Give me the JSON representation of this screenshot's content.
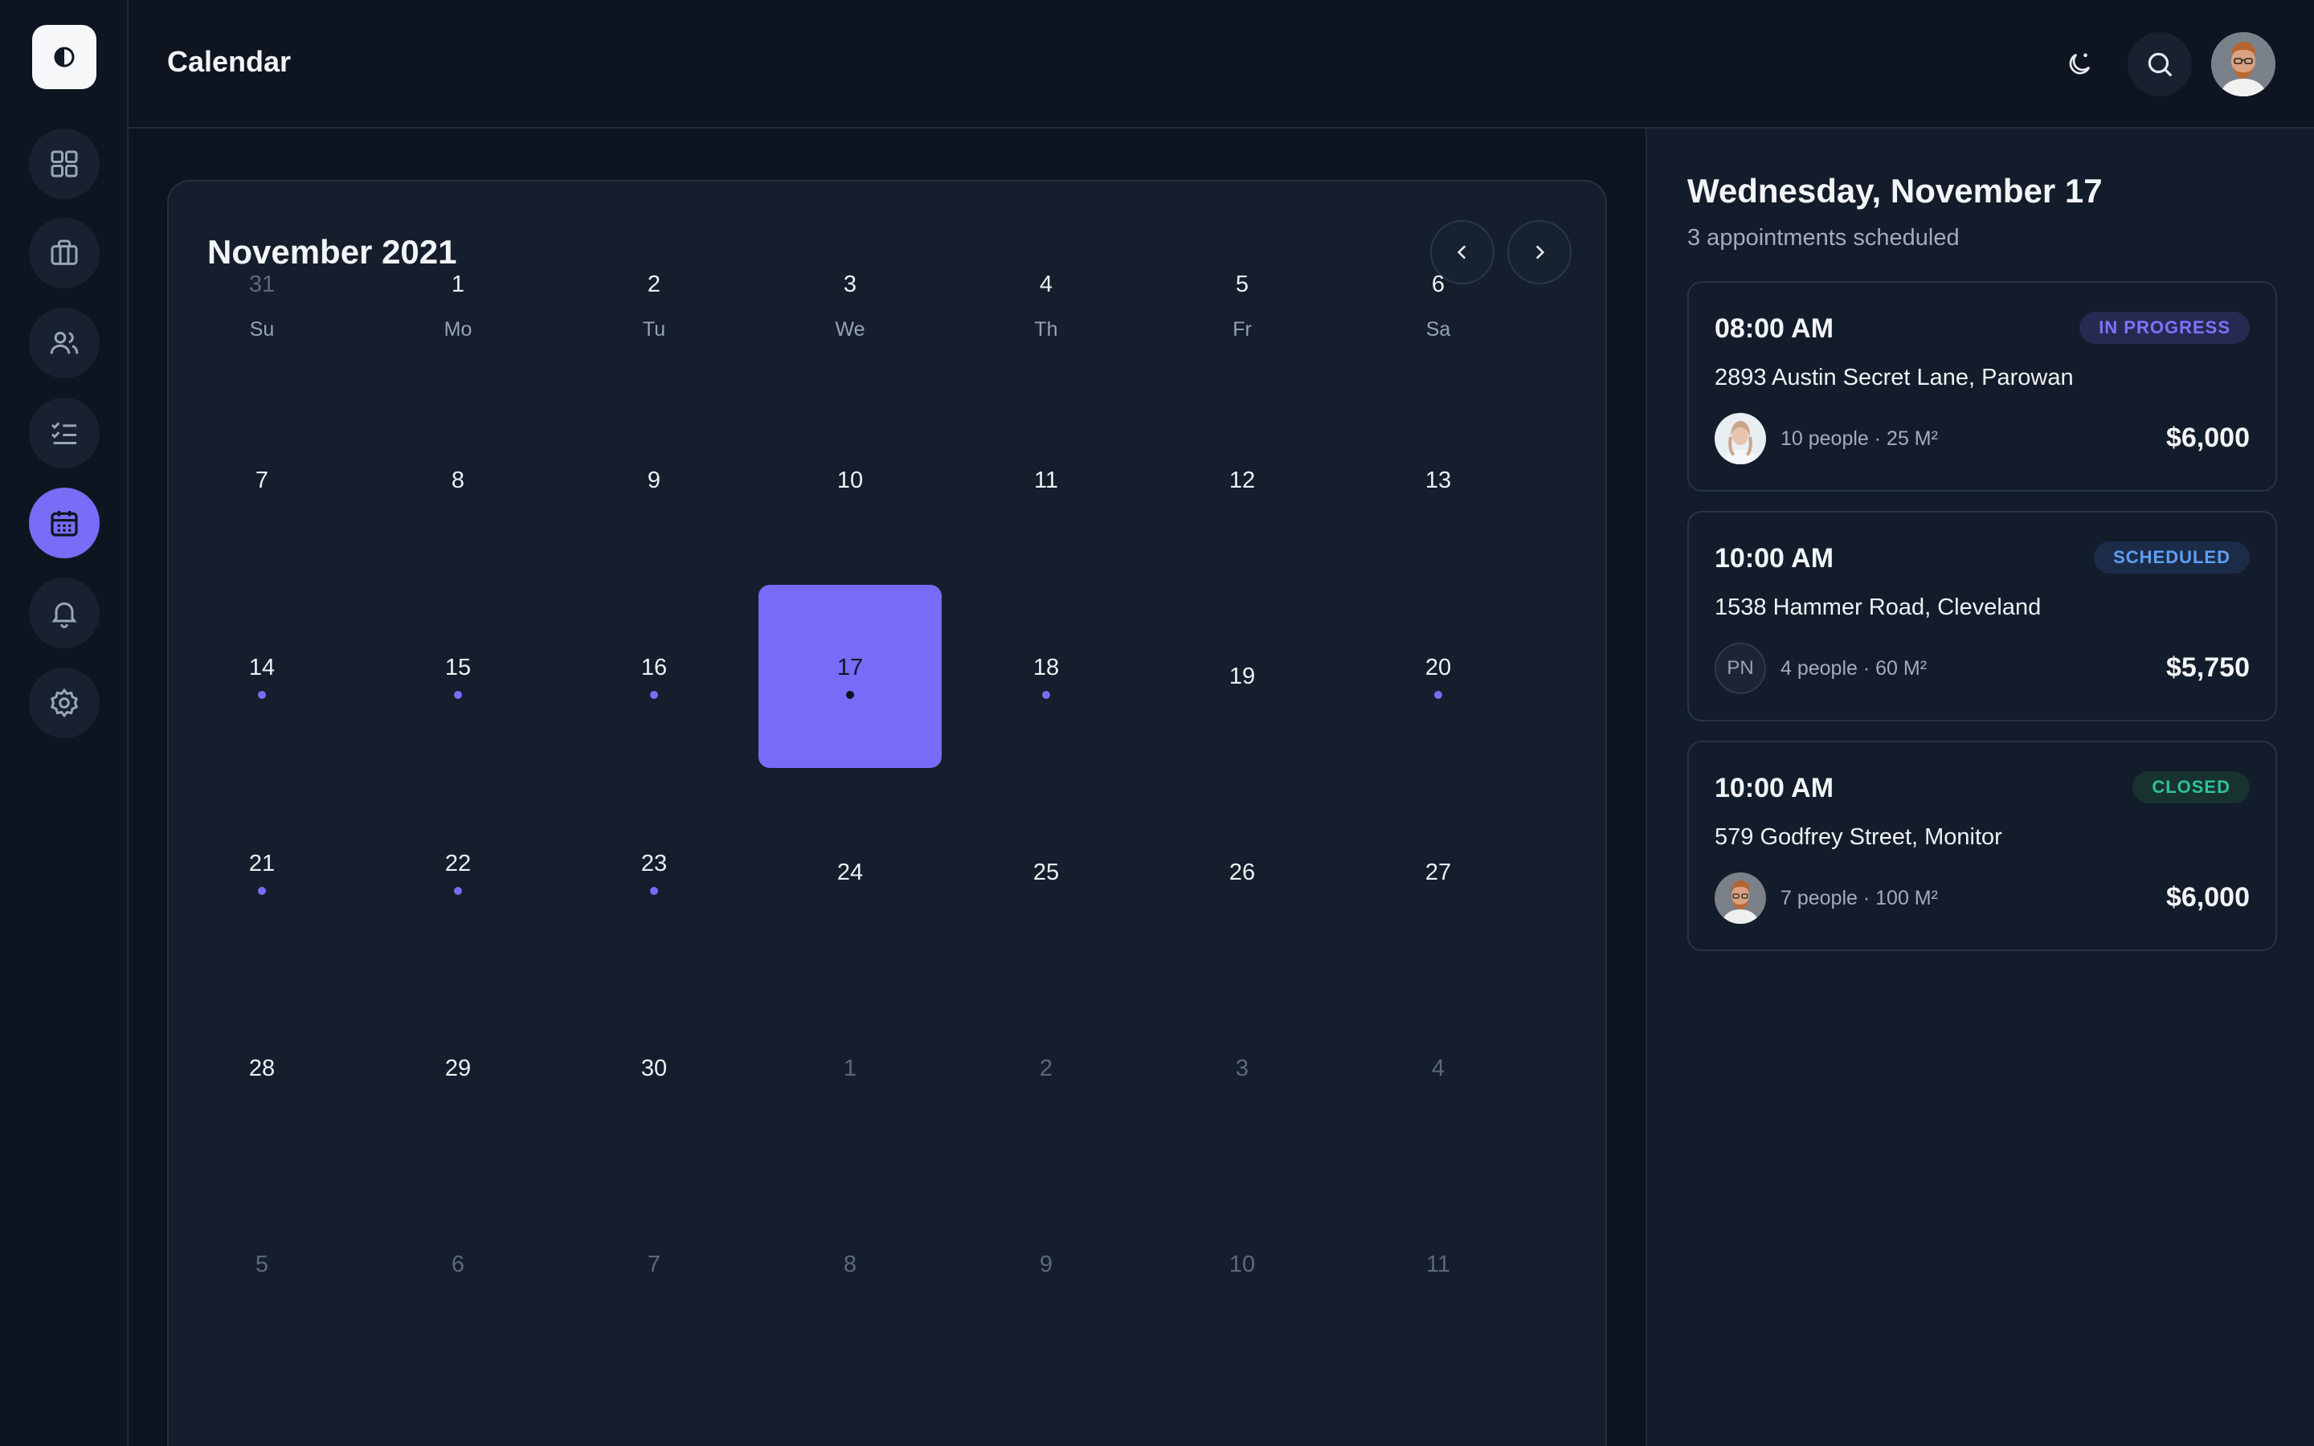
{
  "header": {
    "title": "Calendar"
  },
  "sidebar": {
    "items": [
      {
        "icon": "grid-icon",
        "active": false
      },
      {
        "icon": "briefcase-icon",
        "active": false
      },
      {
        "icon": "users-icon",
        "active": false
      },
      {
        "icon": "checklist-icon",
        "active": false
      },
      {
        "icon": "calendar-icon",
        "active": true
      },
      {
        "icon": "bell-icon",
        "active": false
      },
      {
        "icon": "gear-icon",
        "active": false
      }
    ]
  },
  "calendar": {
    "month_label": "November 2021",
    "weekdays": [
      "Su",
      "Mo",
      "Tu",
      "We",
      "Th",
      "Fr",
      "Sa"
    ],
    "weeks": [
      [
        {
          "d": "31",
          "muted": true
        },
        {
          "d": "1"
        },
        {
          "d": "2"
        },
        {
          "d": "3"
        },
        {
          "d": "4"
        },
        {
          "d": "5"
        },
        {
          "d": "6"
        }
      ],
      [
        {
          "d": "7"
        },
        {
          "d": "8"
        },
        {
          "d": "9"
        },
        {
          "d": "10"
        },
        {
          "d": "11"
        },
        {
          "d": "12"
        },
        {
          "d": "13"
        }
      ],
      [
        {
          "d": "14",
          "dot": true
        },
        {
          "d": "15",
          "dot": true
        },
        {
          "d": "16",
          "dot": true
        },
        {
          "d": "17",
          "dot": true,
          "selected": true
        },
        {
          "d": "18",
          "dot": true
        },
        {
          "d": "19"
        },
        {
          "d": "20",
          "dot": true
        }
      ],
      [
        {
          "d": "21",
          "dot": true
        },
        {
          "d": "22",
          "dot": true
        },
        {
          "d": "23",
          "dot": true
        },
        {
          "d": "24"
        },
        {
          "d": "25"
        },
        {
          "d": "26"
        },
        {
          "d": "27"
        }
      ],
      [
        {
          "d": "28"
        },
        {
          "d": "29"
        },
        {
          "d": "30"
        },
        {
          "d": "1",
          "muted": true
        },
        {
          "d": "2",
          "muted": true
        },
        {
          "d": "3",
          "muted": true
        },
        {
          "d": "4",
          "muted": true
        }
      ],
      [
        {
          "d": "5",
          "muted": true
        },
        {
          "d": "6",
          "muted": true
        },
        {
          "d": "7",
          "muted": true
        },
        {
          "d": "8",
          "muted": true
        },
        {
          "d": "9",
          "muted": true
        },
        {
          "d": "10",
          "muted": true
        },
        {
          "d": "11",
          "muted": true
        }
      ]
    ]
  },
  "day_panel": {
    "title": "Wednesday, November 17",
    "subtitle": "3 appointments scheduled",
    "appointments": [
      {
        "time": "08:00 AM",
        "status": "IN PROGRESS",
        "status_kind": "progress",
        "address": "2893 Austin Secret Lane, Parowan",
        "meta": "10 people · 25 M²",
        "price": "$6,000",
        "avatar": "photo-woman"
      },
      {
        "time": "10:00 AM",
        "status": "SCHEDULED",
        "status_kind": "scheduled",
        "address": "1538 Hammer Road, Cleveland",
        "meta": "4 people · 60 M²",
        "price": "$5,750",
        "avatar_initials": "PN"
      },
      {
        "time": "10:00 AM",
        "status": "CLOSED",
        "status_kind": "closed",
        "address": "579 Godfrey Street, Monitor",
        "meta": "7 people · 100 M²",
        "price": "$6,000",
        "avatar": "photo-man"
      }
    ]
  },
  "colors": {
    "accent": "#7a6cf7",
    "background": "#0f1623",
    "panel": "#141e2c"
  }
}
